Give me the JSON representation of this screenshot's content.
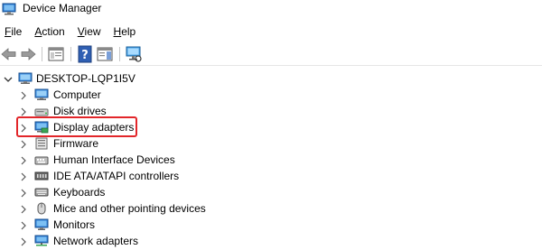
{
  "window": {
    "title": "Device Manager"
  },
  "menu": [
    {
      "key": "F",
      "rest": "ile"
    },
    {
      "key": "A",
      "rest": "ction"
    },
    {
      "key": "V",
      "rest": "iew"
    },
    {
      "key": "H",
      "rest": "elp"
    }
  ],
  "tree": {
    "root_label": "DESKTOP-LQP1I5V",
    "items": [
      {
        "label": "Computer",
        "icon": "computer-icon"
      },
      {
        "label": "Disk drives",
        "icon": "disk-drive-icon"
      },
      {
        "label": "Display adapters",
        "icon": "display-adapter-icon"
      },
      {
        "label": "Firmware",
        "icon": "firmware-icon"
      },
      {
        "label": "Human Interface Devices",
        "icon": "hid-icon"
      },
      {
        "label": "IDE ATA/ATAPI controllers",
        "icon": "ide-controller-icon"
      },
      {
        "label": "Keyboards",
        "icon": "keyboard-icon"
      },
      {
        "label": "Mice and other pointing devices",
        "icon": "mouse-icon"
      },
      {
        "label": "Monitors",
        "icon": "monitor-icon"
      },
      {
        "label": "Network adapters",
        "icon": "network-adapter-icon"
      }
    ]
  },
  "colors": {
    "highlight": "#e2262a",
    "accent_blue": "#1f6fd1"
  }
}
